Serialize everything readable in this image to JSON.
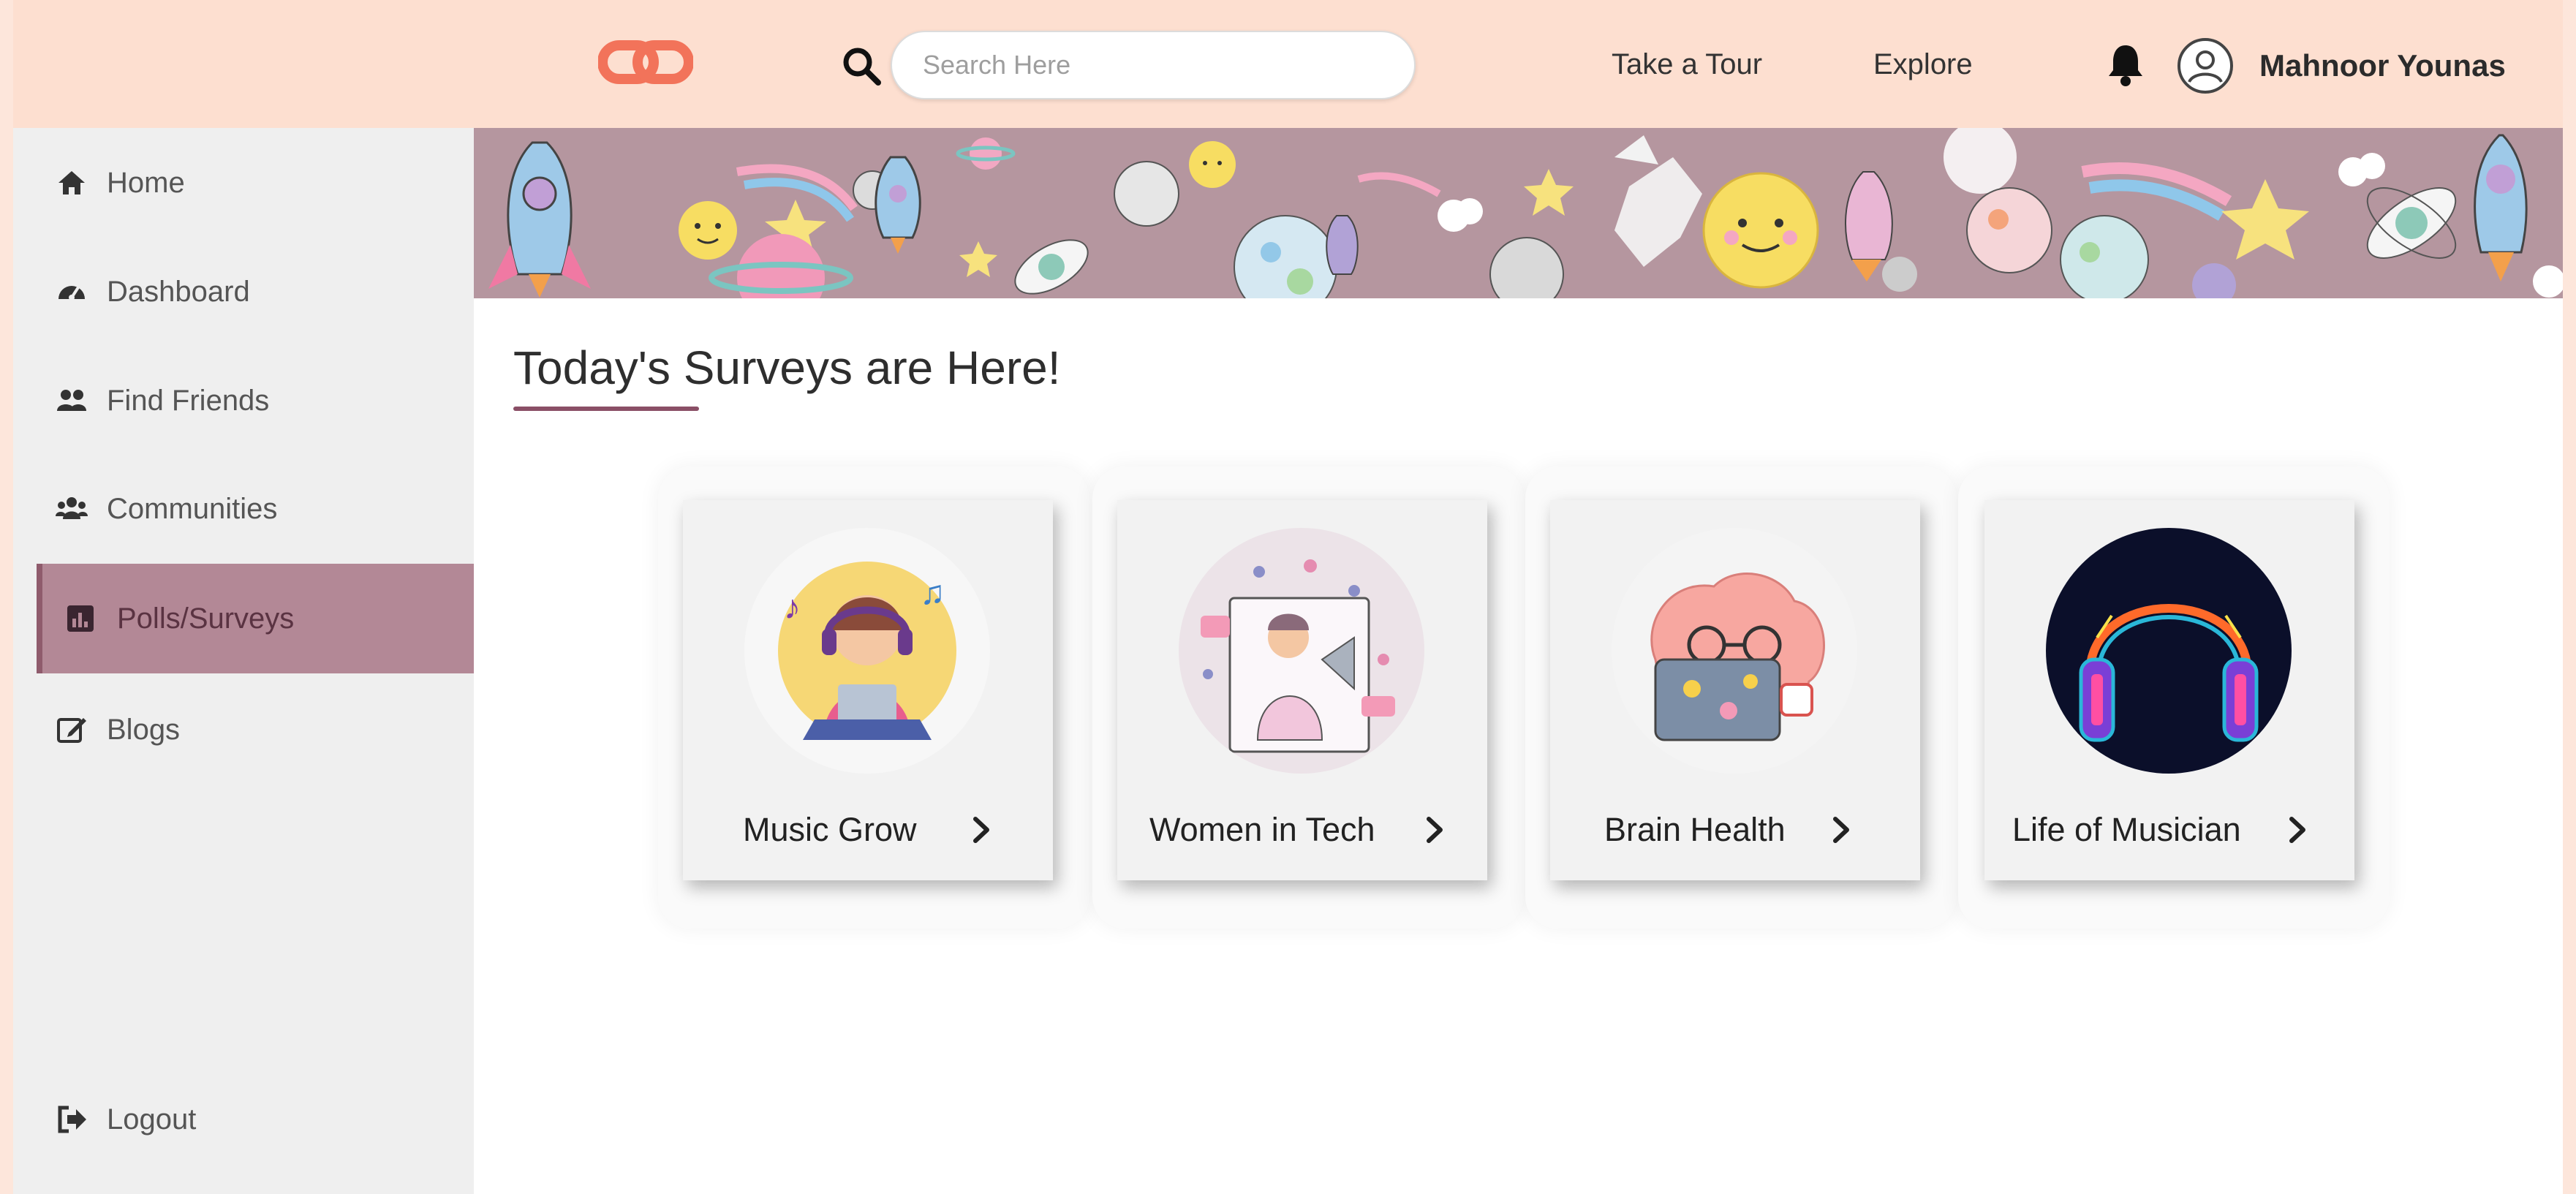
{
  "search": {
    "placeholder": "Search Here"
  },
  "nav": {
    "tour": "Take a Tour",
    "explore": "Explore"
  },
  "user": {
    "name": "Mahnoor Younas"
  },
  "sidebar": {
    "items": [
      {
        "label": "Home",
        "icon": "home-icon"
      },
      {
        "label": "Dashboard",
        "icon": "dashboard-icon"
      },
      {
        "label": "Find Friends",
        "icon": "friends-icon"
      },
      {
        "label": "Communities",
        "icon": "community-icon"
      },
      {
        "label": "Polls/Surveys",
        "icon": "poll-icon",
        "active": true
      },
      {
        "label": "Blogs",
        "icon": "edit-icon"
      }
    ],
    "logout": "Logout"
  },
  "main": {
    "title": "Today's Surveys are Here!",
    "surveys": [
      {
        "name": "Music Grow"
      },
      {
        "name": "Women in Tech"
      },
      {
        "name": "Brain Health"
      },
      {
        "name": "Life of Musician"
      }
    ]
  },
  "colors": {
    "topbar": "#fddfd0",
    "accent": "#b38896",
    "underline": "#8a4f66",
    "logo": "#f2735a"
  }
}
